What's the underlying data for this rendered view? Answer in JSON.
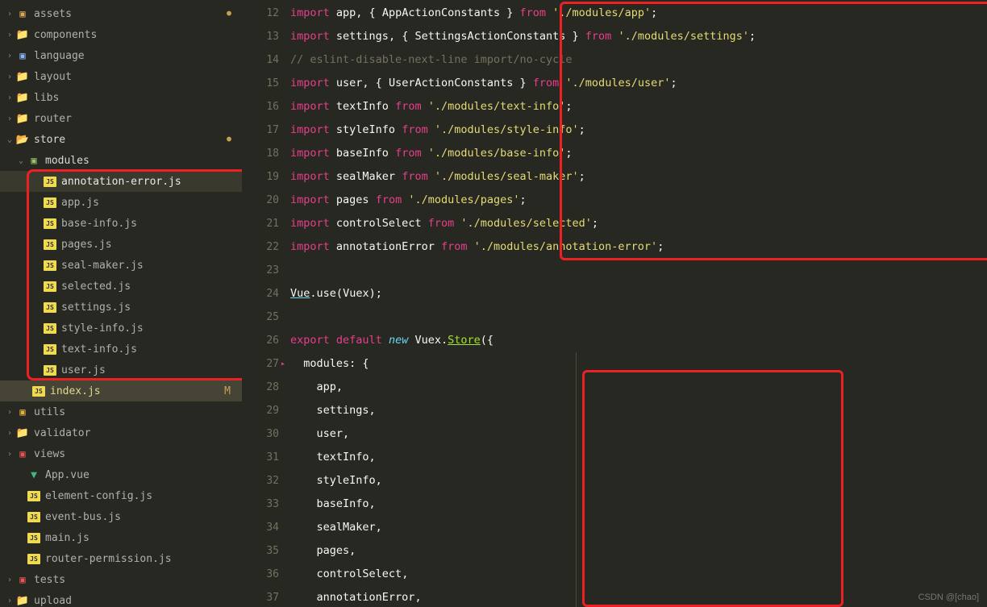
{
  "sidebar": {
    "items": [
      {
        "indent": 6,
        "chev": "›",
        "iconType": "generic",
        "iconColor": "#dca954",
        "name": "assets",
        "dot": true,
        "interact": true
      },
      {
        "indent": 6,
        "chev": "›",
        "iconType": "folder",
        "name": "components",
        "interact": true
      },
      {
        "indent": 6,
        "chev": "›",
        "iconType": "generic",
        "iconColor": "#8ab4f8",
        "name": "language",
        "interact": true
      },
      {
        "indent": 6,
        "chev": "›",
        "iconType": "folder",
        "iconColor": "#dca954",
        "name": "layout",
        "interact": true
      },
      {
        "indent": 6,
        "chev": "›",
        "iconType": "folder",
        "iconColor": "#dca954",
        "name": "libs",
        "interact": true
      },
      {
        "indent": 6,
        "chev": "›",
        "iconType": "folder",
        "iconColor": "#dca954",
        "name": "router",
        "interact": true
      },
      {
        "indent": 6,
        "chev": "⌄",
        "iconType": "folder-open",
        "name": "store",
        "dot": true,
        "open": true,
        "interact": true
      },
      {
        "indent": 20,
        "chev": "⌄",
        "iconType": "generic",
        "iconColor": "#9cc26a",
        "name": "modules",
        "open": true,
        "interact": true
      },
      {
        "indent": 40,
        "chev": "",
        "iconType": "js",
        "name": "annotation-error.js",
        "active": true,
        "interact": true
      },
      {
        "indent": 40,
        "chev": "",
        "iconType": "js",
        "name": "app.js",
        "interact": true
      },
      {
        "indent": 40,
        "chev": "",
        "iconType": "js",
        "name": "base-info.js",
        "interact": true
      },
      {
        "indent": 40,
        "chev": "",
        "iconType": "js",
        "name": "pages.js",
        "interact": true
      },
      {
        "indent": 40,
        "chev": "",
        "iconType": "js",
        "name": "seal-maker.js",
        "interact": true
      },
      {
        "indent": 40,
        "chev": "",
        "iconType": "js",
        "name": "selected.js",
        "interact": true
      },
      {
        "indent": 40,
        "chev": "",
        "iconType": "js",
        "name": "settings.js",
        "interact": true
      },
      {
        "indent": 40,
        "chev": "",
        "iconType": "js",
        "name": "style-info.js",
        "interact": true
      },
      {
        "indent": 40,
        "chev": "",
        "iconType": "js",
        "name": "text-info.js",
        "interact": true
      },
      {
        "indent": 40,
        "chev": "",
        "iconType": "js",
        "name": "user.js",
        "interact": true
      },
      {
        "indent": 26,
        "chev": "",
        "iconType": "js",
        "name": "index.js",
        "modified": "M",
        "interact": true
      },
      {
        "indent": 6,
        "chev": "›",
        "iconType": "generic",
        "iconColor": "#e3b341",
        "name": "utils",
        "interact": true
      },
      {
        "indent": 6,
        "chev": "›",
        "iconType": "folder",
        "name": "validator",
        "interact": true
      },
      {
        "indent": 6,
        "chev": "›",
        "iconType": "generic",
        "iconColor": "#e85555",
        "name": "views",
        "interact": true
      },
      {
        "indent": 20,
        "chev": "",
        "iconType": "vue",
        "name": "App.vue",
        "interact": true
      },
      {
        "indent": 20,
        "chev": "",
        "iconType": "js",
        "name": "element-config.js",
        "interact": true
      },
      {
        "indent": 20,
        "chev": "",
        "iconType": "js",
        "name": "event-bus.js",
        "interact": true
      },
      {
        "indent": 20,
        "chev": "",
        "iconType": "js",
        "name": "main.js",
        "interact": true
      },
      {
        "indent": 20,
        "chev": "",
        "iconType": "js",
        "name": "router-permission.js",
        "interact": true
      },
      {
        "indent": 6,
        "chev": "›",
        "iconType": "generic",
        "iconColor": "#e85555",
        "name": "tests",
        "interact": true
      },
      {
        "indent": 6,
        "chev": "›",
        "iconType": "folder",
        "name": "upload",
        "interact": true
      }
    ]
  },
  "editor": {
    "startLine": 12,
    "lines": [
      {
        "n": 12,
        "t": [
          [
            "kw-import",
            "import"
          ],
          [
            "ident",
            " app"
          ],
          [
            "punct",
            ", { "
          ],
          [
            "ident",
            "AppActionConstants"
          ],
          [
            "punct",
            " } "
          ],
          [
            "kw-from",
            "from"
          ],
          [
            "punct",
            " "
          ],
          [
            "str",
            "'./modules/app'"
          ],
          [
            "punct",
            ";"
          ]
        ]
      },
      {
        "n": 13,
        "t": [
          [
            "kw-import",
            "import"
          ],
          [
            "ident",
            " settings"
          ],
          [
            "punct",
            ", { "
          ],
          [
            "ident",
            "SettingsActionConstants"
          ],
          [
            "punct",
            " } "
          ],
          [
            "kw-from",
            "from"
          ],
          [
            "punct",
            " "
          ],
          [
            "str",
            "'./modules/settings'"
          ],
          [
            "punct",
            ";"
          ]
        ]
      },
      {
        "n": 14,
        "t": [
          [
            "comment",
            "// eslint-disable-next-line import/no-cycle"
          ]
        ]
      },
      {
        "n": 15,
        "t": [
          [
            "kw-import",
            "import"
          ],
          [
            "ident",
            " user"
          ],
          [
            "punct",
            ", { "
          ],
          [
            "ident",
            "UserActionConstants"
          ],
          [
            "punct",
            " } "
          ],
          [
            "kw-from",
            "from"
          ],
          [
            "punct",
            " "
          ],
          [
            "str",
            "'./modules/user'"
          ],
          [
            "punct",
            ";"
          ]
        ]
      },
      {
        "n": 16,
        "t": [
          [
            "kw-import",
            "import"
          ],
          [
            "ident",
            " textInfo "
          ],
          [
            "kw-from",
            "from"
          ],
          [
            "punct",
            " "
          ],
          [
            "str",
            "'./modules/text-info'"
          ],
          [
            "punct",
            ";"
          ]
        ]
      },
      {
        "n": 17,
        "t": [
          [
            "kw-import",
            "import"
          ],
          [
            "ident",
            " styleInfo "
          ],
          [
            "kw-from",
            "from"
          ],
          [
            "punct",
            " "
          ],
          [
            "str",
            "'./modules/style-info'"
          ],
          [
            "punct",
            ";"
          ]
        ]
      },
      {
        "n": 18,
        "t": [
          [
            "kw-import",
            "import"
          ],
          [
            "ident",
            " baseInfo "
          ],
          [
            "kw-from",
            "from"
          ],
          [
            "punct",
            " "
          ],
          [
            "str",
            "'./modules/base-info'"
          ],
          [
            "punct",
            ";"
          ]
        ]
      },
      {
        "n": 19,
        "t": [
          [
            "kw-import",
            "import"
          ],
          [
            "ident",
            " sealMaker "
          ],
          [
            "kw-from",
            "from"
          ],
          [
            "punct",
            " "
          ],
          [
            "str",
            "'./modules/seal-maker'"
          ],
          [
            "punct",
            ";"
          ]
        ]
      },
      {
        "n": 20,
        "t": [
          [
            "kw-import",
            "import"
          ],
          [
            "ident",
            " pages "
          ],
          [
            "kw-from",
            "from"
          ],
          [
            "punct",
            " "
          ],
          [
            "str",
            "'./modules/pages'"
          ],
          [
            "punct",
            ";"
          ]
        ]
      },
      {
        "n": 21,
        "t": [
          [
            "kw-import",
            "import"
          ],
          [
            "ident",
            " controlSelect "
          ],
          [
            "kw-from",
            "from"
          ],
          [
            "punct",
            " "
          ],
          [
            "str",
            "'./modules/selected'"
          ],
          [
            "punct",
            ";"
          ]
        ]
      },
      {
        "n": 22,
        "t": [
          [
            "kw-import",
            "import"
          ],
          [
            "ident",
            " annotationError "
          ],
          [
            "kw-from",
            "from"
          ],
          [
            "punct",
            " "
          ],
          [
            "str",
            "'./modules/annotation-error'"
          ],
          [
            "punct",
            ";"
          ]
        ]
      },
      {
        "n": 23,
        "t": []
      },
      {
        "n": 24,
        "t": [
          [
            "classref",
            "Vue"
          ],
          [
            "punct",
            "."
          ],
          [
            "ident",
            "use"
          ],
          [
            "punct",
            "("
          ],
          [
            "ident",
            "Vuex"
          ],
          [
            "punct",
            ");"
          ]
        ]
      },
      {
        "n": 25,
        "t": []
      },
      {
        "n": 26,
        "t": [
          [
            "kw-export",
            "export"
          ],
          [
            "punct",
            " "
          ],
          [
            "kw-default",
            "default"
          ],
          [
            "punct",
            " "
          ],
          [
            "kw-new",
            "new"
          ],
          [
            "punct",
            " "
          ],
          [
            "ident",
            "Vuex"
          ],
          [
            "punct",
            "."
          ],
          [
            "methodref",
            "Store"
          ],
          [
            "punct",
            "({"
          ]
        ]
      },
      {
        "n": 27,
        "marker": true,
        "t": [
          [
            "punct",
            "  "
          ],
          [
            "prop",
            "modules"
          ],
          [
            "punct",
            ": {"
          ]
        ]
      },
      {
        "n": 28,
        "t": [
          [
            "punct",
            "    "
          ],
          [
            "ident",
            "app"
          ],
          [
            "punct",
            ","
          ]
        ]
      },
      {
        "n": 29,
        "t": [
          [
            "punct",
            "    "
          ],
          [
            "ident",
            "settings"
          ],
          [
            "punct",
            ","
          ]
        ]
      },
      {
        "n": 30,
        "t": [
          [
            "punct",
            "    "
          ],
          [
            "ident",
            "user"
          ],
          [
            "punct",
            ","
          ]
        ]
      },
      {
        "n": 31,
        "t": [
          [
            "punct",
            "    "
          ],
          [
            "ident",
            "textInfo"
          ],
          [
            "punct",
            ","
          ]
        ]
      },
      {
        "n": 32,
        "t": [
          [
            "punct",
            "    "
          ],
          [
            "ident",
            "styleInfo"
          ],
          [
            "punct",
            ","
          ]
        ]
      },
      {
        "n": 33,
        "t": [
          [
            "punct",
            "    "
          ],
          [
            "ident",
            "baseInfo"
          ],
          [
            "punct",
            ","
          ]
        ]
      },
      {
        "n": 34,
        "t": [
          [
            "punct",
            "    "
          ],
          [
            "ident",
            "sealMaker"
          ],
          [
            "punct",
            ","
          ]
        ]
      },
      {
        "n": 35,
        "t": [
          [
            "punct",
            "    "
          ],
          [
            "ident",
            "pages"
          ],
          [
            "punct",
            ","
          ]
        ]
      },
      {
        "n": 36,
        "t": [
          [
            "punct",
            "    "
          ],
          [
            "ident",
            "controlSelect"
          ],
          [
            "punct",
            ","
          ]
        ]
      },
      {
        "n": 37,
        "t": [
          [
            "punct",
            "    "
          ],
          [
            "ident",
            "annotationError"
          ],
          [
            "punct",
            ","
          ]
        ]
      }
    ]
  },
  "watermark": "CSDN @[chao]"
}
